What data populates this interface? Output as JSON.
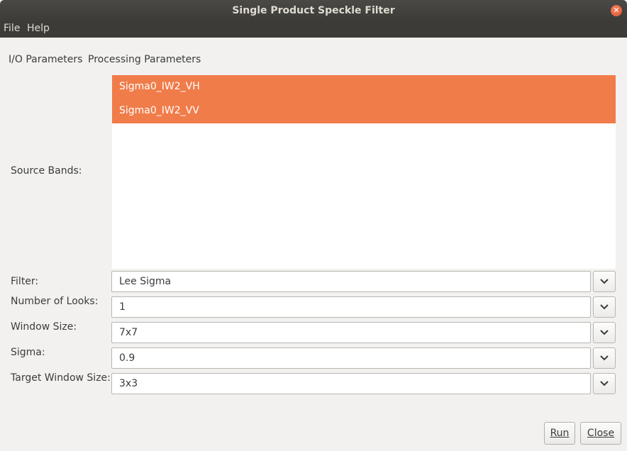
{
  "window": {
    "title": "Single Product Speckle Filter"
  },
  "menu": [
    {
      "label": "File"
    },
    {
      "label": "Help"
    }
  ],
  "tabs": [
    {
      "label": "I/O Parameters"
    },
    {
      "label": "Processing Parameters"
    }
  ],
  "source_bands": {
    "label": "Source Bands:",
    "items": [
      "Sigma0_IW2_VH",
      "Sigma0_IW2_VV"
    ],
    "selected_color": "#f07c4a"
  },
  "params": {
    "filter": {
      "label": "Filter:",
      "value": "Lee Sigma"
    },
    "num_looks": {
      "label": "Number of Looks:",
      "value": "1"
    },
    "window_size": {
      "label": "Window Size:",
      "value": "7x7"
    },
    "sigma": {
      "label": "Sigma:",
      "value": "0.9"
    },
    "target_window_size": {
      "label": "Target Window Size:",
      "value": "3x3"
    }
  },
  "buttons": {
    "run": "Run",
    "close": "Close"
  },
  "icons": {
    "close": "close-icon",
    "dropdown": "chevron-down-icon"
  }
}
